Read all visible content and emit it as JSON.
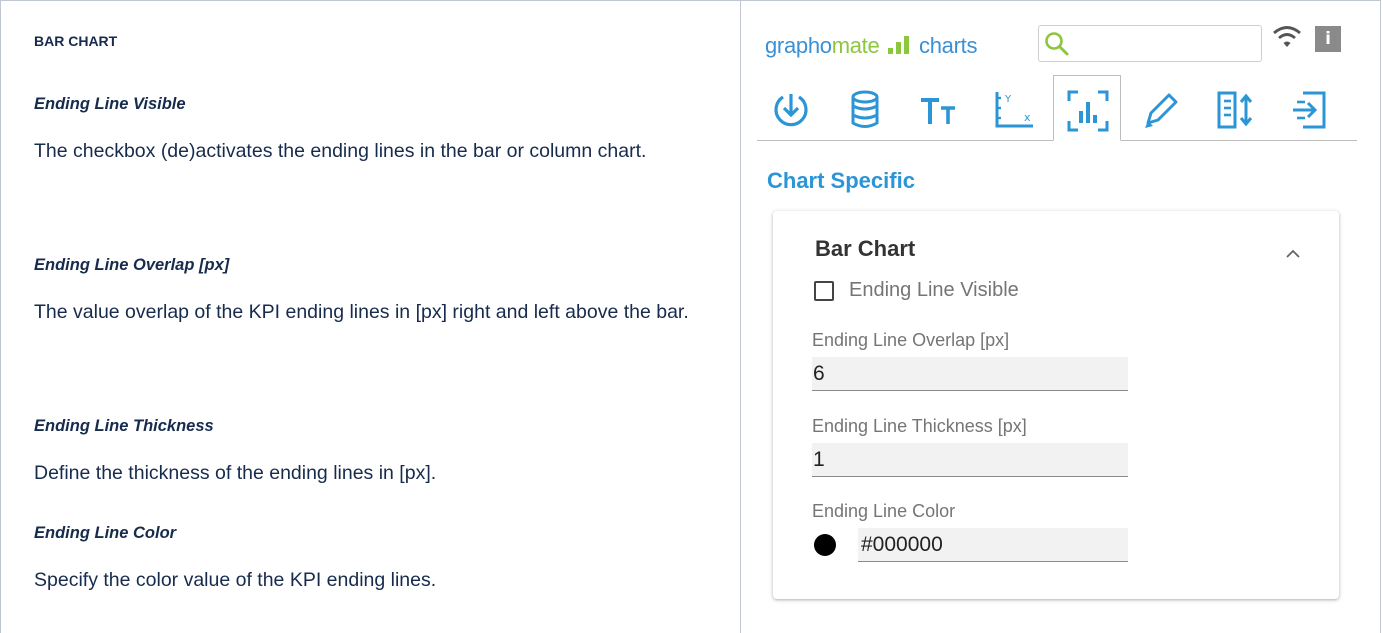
{
  "doc": {
    "section_heading": "BAR CHART",
    "items": [
      {
        "title": "Ending Line Visible",
        "body": "The checkbox (de)activates the ending lines in the bar or column chart."
      },
      {
        "title": "Ending Line Overlap [px]",
        "body": "The value overlap of the KPI ending lines in [px] right and left above the bar."
      },
      {
        "title": "Ending Line Thickness",
        "body": "Define the thickness of the ending lines in [px]."
      },
      {
        "title": "Ending Line Color",
        "body": "Specify the color value of the KPI ending lines."
      }
    ]
  },
  "panel": {
    "brand": {
      "part1": "grapho",
      "part2": "mate",
      "part3": "charts"
    },
    "search": {
      "value": "",
      "placeholder": ""
    },
    "icons": {
      "search": "search-icon",
      "wifi": "wifi-icon",
      "info": "info-icon",
      "info_glyph": "i"
    },
    "tabs": [
      {
        "icon": "data-download-icon",
        "active": false
      },
      {
        "icon": "database-icon",
        "active": false
      },
      {
        "icon": "text-size-icon",
        "active": false
      },
      {
        "icon": "axis-icon",
        "active": false
      },
      {
        "icon": "chart-specific-icon",
        "active": true
      },
      {
        "icon": "pencil-icon",
        "active": false
      },
      {
        "icon": "layout-sort-icon",
        "active": false
      },
      {
        "icon": "export-icon",
        "active": false
      }
    ],
    "section_title": "Chart Specific",
    "card": {
      "title": "Bar Chart",
      "collapse_icon": "chevron-up-icon",
      "checkbox_label": "Ending Line Visible",
      "checkbox_checked": false,
      "overlap_label": "Ending Line Overlap [px]",
      "overlap_value": "6",
      "thickness_label": "Ending Line Thickness [px]",
      "thickness_value": "1",
      "color_label": "Ending Line Color",
      "color_value": "#000000"
    }
  },
  "colors": {
    "brand_blue": "#3b8fd4",
    "brand_green": "#8dc63f",
    "section_title": "#2b95d6",
    "text": "#172b4d",
    "ending_line": "#000000"
  }
}
